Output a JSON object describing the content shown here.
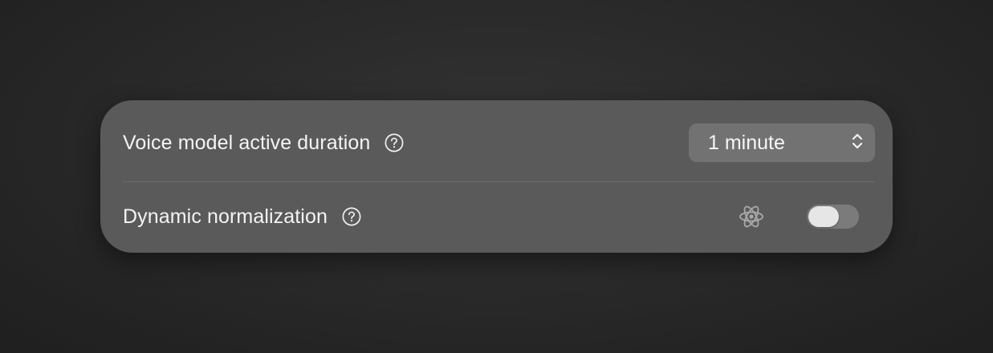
{
  "settings": {
    "rows": [
      {
        "label": "Voice model active duration",
        "help_icon": "question-circle-icon",
        "select": {
          "value": "1 minute",
          "icon": "chevron-up-down-icon"
        }
      },
      {
        "label": "Dynamic normalization",
        "help_icon": "question-circle-icon",
        "feature_icon": "atom-icon",
        "toggle": {
          "on": false
        }
      }
    ]
  },
  "colors": {
    "panel": "#5a5a5a",
    "select_bg": "#727272",
    "toggle_off": "#7b7b7b",
    "text": "#f4f4f4"
  }
}
